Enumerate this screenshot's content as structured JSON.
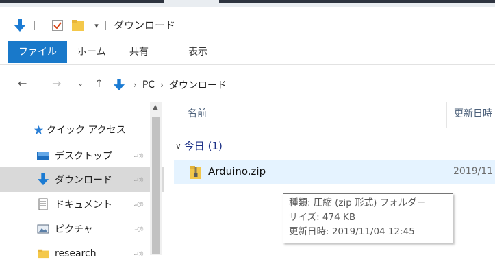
{
  "title": {
    "quick_access_icons": [
      "download-arrow-icon",
      "properties-check-icon",
      "folder-icon",
      "customize-dropdown-icon"
    ],
    "text": "ダウンロード"
  },
  "ribbon": {
    "tabs": [
      "ファイル",
      "ホーム",
      "共有",
      "表示"
    ],
    "active": "ファイル",
    "accent": "#1979ca"
  },
  "address": {
    "back_icon": "back-arrow-icon",
    "forward_icon": "forward-arrow-icon",
    "recent_icon": "recent-chevron-icon",
    "up_icon": "up-arrow-icon",
    "crumbs": [
      "PC",
      "ダウンロード"
    ]
  },
  "nav": {
    "items": [
      {
        "label": "クイック アクセス",
        "icon": "star-icon",
        "pinned": false
      },
      {
        "label": "デスクトップ",
        "icon": "desktop-icon",
        "pinned": true
      },
      {
        "label": "ダウンロード",
        "icon": "download-arrow-icon",
        "pinned": true,
        "selected": true
      },
      {
        "label": "ドキュメント",
        "icon": "document-icon",
        "pinned": true
      },
      {
        "label": "ピクチャ",
        "icon": "pictures-icon",
        "pinned": true
      },
      {
        "label": "research",
        "icon": "folder-icon",
        "pinned": true
      }
    ]
  },
  "content": {
    "columns": [
      "名前",
      "更新日時"
    ],
    "group": "今日 (1)",
    "files": [
      {
        "name": "Arduino.zip",
        "date": "2019/11"
      }
    ]
  },
  "tooltip": {
    "lines": [
      "種類: 圧縮 (zip 形式) フォルダー",
      "サイズ: 474 KB",
      "更新日時: 2019/11/04 12:45"
    ]
  }
}
